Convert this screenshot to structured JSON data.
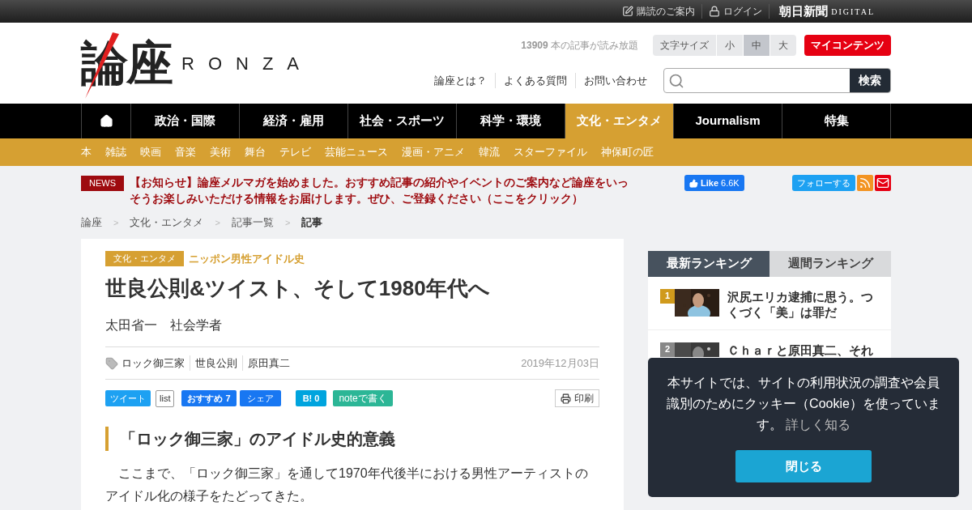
{
  "top_bar": {
    "links": [
      {
        "kind": "edit",
        "label": "購読のご案内"
      },
      {
        "kind": "lock",
        "label": "ログイン"
      }
    ],
    "brand": "朝日新聞",
    "brand_sub": "DIGITAL"
  },
  "header": {
    "logo": "論座",
    "logo_latin": "RONZA",
    "article_count": "13909",
    "article_count_suffix": "本の記事が読み放題",
    "font_size_label": "文字サイズ",
    "font_sizes": [
      {
        "label": "小",
        "selected": false
      },
      {
        "label": "中",
        "selected": true
      },
      {
        "label": "大",
        "selected": false
      }
    ],
    "my_contents": "マイコンテンツ",
    "links": [
      "論座とは？",
      "よくある質問",
      "お問い合わせ"
    ],
    "search": {
      "button": "検索"
    }
  },
  "nav": {
    "items": [
      {
        "kind": "home",
        "selected": false
      },
      {
        "kind": "text",
        "label": "政治・国際",
        "selected": false
      },
      {
        "kind": "text",
        "label": "経済・雇用",
        "selected": false
      },
      {
        "kind": "text",
        "label": "社会・スポーツ",
        "selected": false
      },
      {
        "kind": "text",
        "label": "科学・環境",
        "selected": false
      },
      {
        "kind": "text",
        "label": "文化・エンタメ",
        "selected": true
      },
      {
        "kind": "text",
        "label": "Journalism",
        "selected": false
      },
      {
        "kind": "text",
        "label": "特集",
        "selected": false
      }
    ],
    "sub_items": [
      "本",
      "雑誌",
      "映画",
      "音楽",
      "美術",
      "舞台",
      "テレビ",
      "芸能ニュース",
      "漫画・アニメ",
      "韓流",
      "スターファイル",
      "神保町の匠"
    ]
  },
  "news": {
    "badge": "NEWS",
    "text": "【お知らせ】論座メルマガを始めました。おすすめ記事の紹介やイベントのご案内など論座をいっそうお楽しみいただける情報をお届けします。ぜひ、ご登録ください（ここをクリック）"
  },
  "social": {
    "like": "Like",
    "like_count": "6.6K",
    "follow": "フォローする"
  },
  "breadcrumb": [
    {
      "label": "論座",
      "current": false
    },
    {
      "label": "文化・エンタメ",
      "current": false
    },
    {
      "label": "記事一覧",
      "current": false
    },
    {
      "label": "記事",
      "current": true
    }
  ],
  "breadcrumb_separator": ">",
  "article": {
    "category": "文化・エンタメ",
    "series": "ニッポン男性アイドル史",
    "title": "世良公則&ツイスト、そして1980年代へ",
    "author": "太田省一",
    "author_role": "社会学者",
    "tags": [
      "ロック御三家",
      "世良公則",
      "原田真二"
    ],
    "date": "2019年12月03日",
    "share": {
      "tweet": "ツイート",
      "list": "list",
      "recommend": "おすすめ",
      "recommend_count": "7",
      "share": "シェア",
      "hatena": "B!",
      "hatena_count": "0",
      "note": "noteで書く",
      "print": "印刷"
    },
    "section_heading": "「ロック御三家」のアイドル史的意義",
    "paragraph": "ここまで、「ロック御三家」を通して1970年代後半における男性アーティストのアイドル化の様子をたどってきた。"
  },
  "ranking": {
    "tabs": [
      {
        "label": "最新ランキング",
        "selected": true
      },
      {
        "label": "週間ランキング",
        "selected": false
      }
    ],
    "items": [
      {
        "rank": "1",
        "title": "沢尻エリカ逮捕に思う。つくづく「美」は罪だ",
        "color": "#d09a1c"
      },
      {
        "rank": "2",
        "title": "Ｃｈａｒと原田真二、それ",
        "color": "#888888"
      }
    ]
  },
  "cookie": {
    "text": "本サイトでは、サイトの利用状況の調査や会員識別のためにクッキー（Cookie）を使っています。",
    "link": "詳しく知る",
    "button": "閉じる"
  }
}
